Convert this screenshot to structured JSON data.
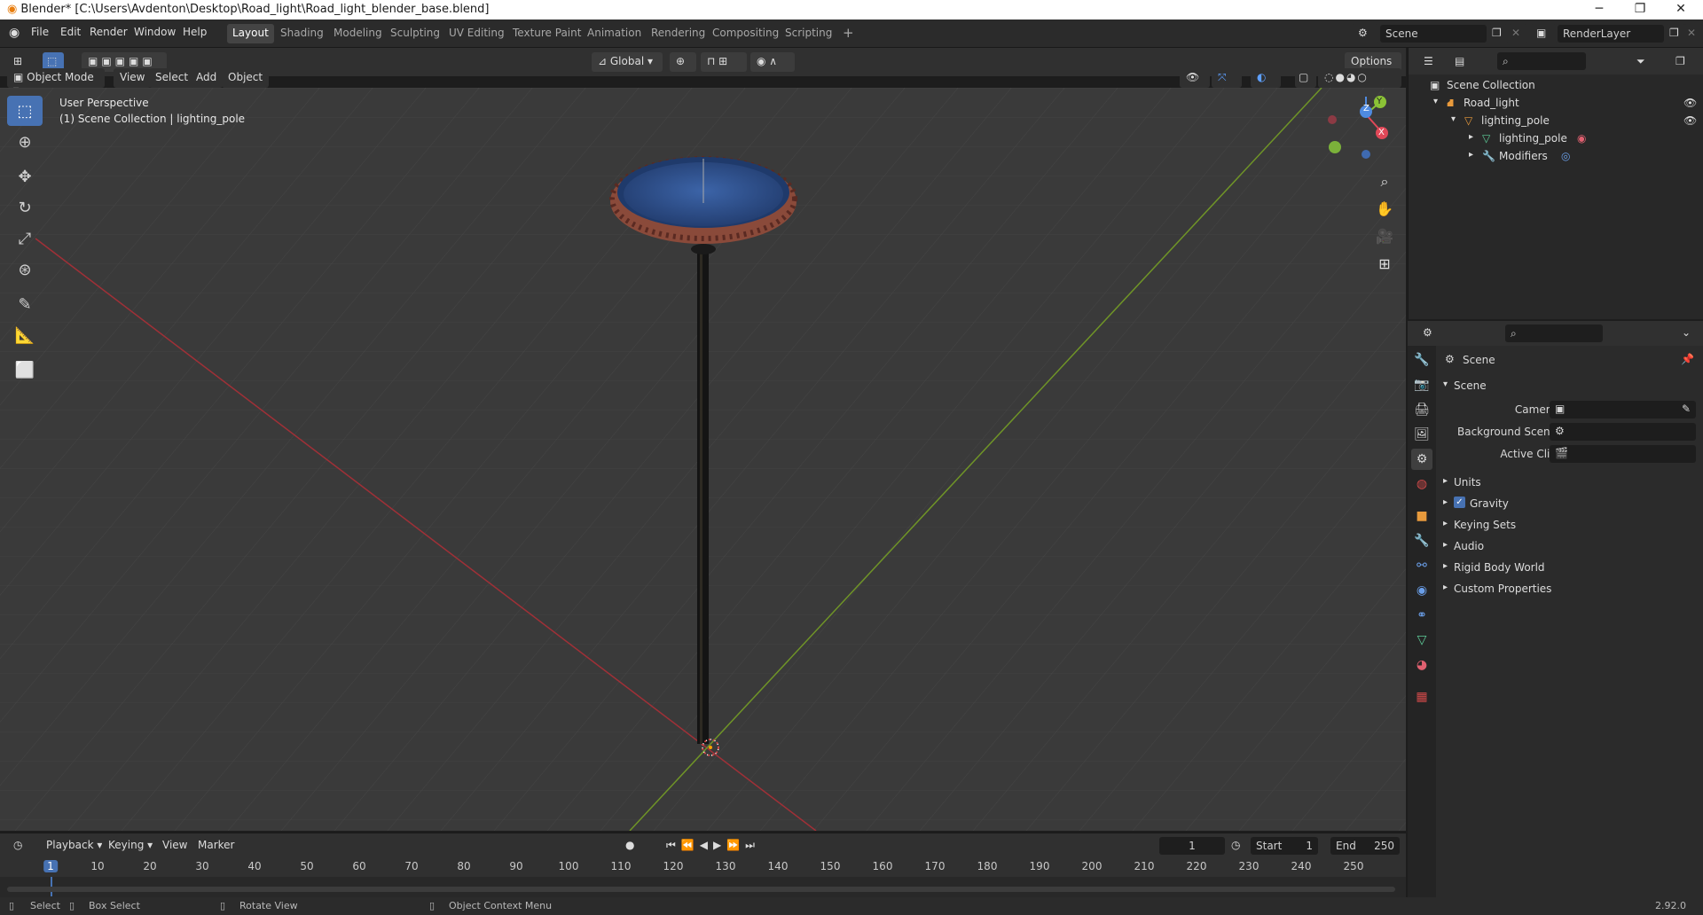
{
  "titlebar": {
    "title": "Blender* [C:\\Users\\Avdenton\\Desktop\\Road_light\\Road_light_blender_base.blend]"
  },
  "menus": [
    "File",
    "Edit",
    "Render",
    "Window",
    "Help"
  ],
  "workspaces": [
    "Layout",
    "Shading",
    "Modeling",
    "Sculpting",
    "UV Editing",
    "Texture Paint",
    "Animation",
    "Rendering",
    "Compositing",
    "Scripting"
  ],
  "active_workspace": "Layout",
  "scene_field": "Scene",
  "renderlayer_field": "RenderLayer",
  "viewport": {
    "mode": "Object Mode",
    "menus": [
      "View",
      "Select",
      "Add",
      "Object"
    ],
    "transform_orientation": "Global",
    "options_label": "Options",
    "overlay_text_1": "User Perspective",
    "overlay_text_2": "(1) Scene Collection | lighting_pole",
    "gizmo": {
      "x": "X",
      "y": "Y",
      "z": "Z"
    }
  },
  "outliner": {
    "rows": [
      {
        "label": "Scene Collection"
      },
      {
        "label": "Road_light"
      },
      {
        "label": "lighting_pole"
      },
      {
        "label": "lighting_pole"
      },
      {
        "label": "Modifiers"
      }
    ]
  },
  "properties": {
    "header": "Scene",
    "panel": "Scene",
    "camera_label": "Camera",
    "bg_scene_label": "Background Scene",
    "active_clip_label": "Active Clip",
    "sections": [
      "Units",
      "Gravity",
      "Keying Sets",
      "Audio",
      "Rigid Body World",
      "Custom Properties"
    ],
    "gravity_checked": true
  },
  "timeline": {
    "menus": [
      "Playback",
      "Keying",
      "View",
      "Marker"
    ],
    "current_frame": "1",
    "start_label": "Start",
    "start": "1",
    "end_label": "End",
    "end": "250",
    "ticks": [
      "1",
      "10",
      "20",
      "30",
      "40",
      "50",
      "60",
      "70",
      "80",
      "90",
      "100",
      "110",
      "120",
      "130",
      "140",
      "150",
      "160",
      "170",
      "180",
      "190",
      "200",
      "210",
      "220",
      "230",
      "240",
      "250"
    ]
  },
  "statusbar": {
    "select": "Select",
    "box_select": "Box Select",
    "rotate_view": "Rotate View",
    "context_menu": "Object Context Menu",
    "version": "2.92.0"
  }
}
